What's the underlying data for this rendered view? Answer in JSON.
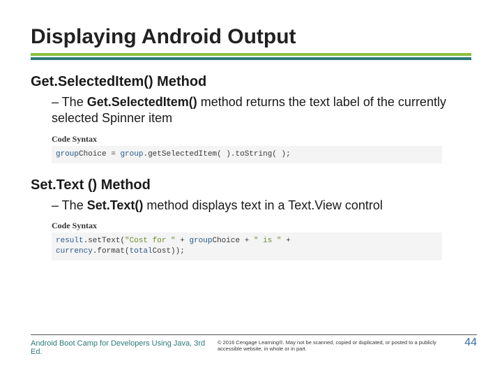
{
  "title": "Displaying Android Output",
  "sections": {
    "get_selected": {
      "heading": "Get.SelectedItem() Method",
      "bullet_prefix": "– The ",
      "bullet_bold": "Get.SelectedItem()",
      "bullet_rest": " method returns the text label of the currently selected Spinner item",
      "syntax_label": "Code Syntax",
      "code_plain": "groupChoice = group.getSelectedItem( ).toString( );"
    },
    "set_text": {
      "heading": "Set.Text () Method",
      "bullet_prefix": "– The ",
      "bullet_bold": "Set.Text()",
      "bullet_rest": " method displays text in a Text.View control",
      "syntax_label": "Code Syntax",
      "code_plain": "result.setText(\"Cost for \" + groupChoice + \" is \" + currency.format(totalCost));"
    }
  },
  "footer": {
    "left": "Android Boot Camp for Developers Using Java, 3rd Ed.",
    "mid": "© 2016 Cengage Learning®. May not be scanned, copied or duplicated, or posted to a publicly accessible website, in whole or in part.",
    "page": "44"
  }
}
